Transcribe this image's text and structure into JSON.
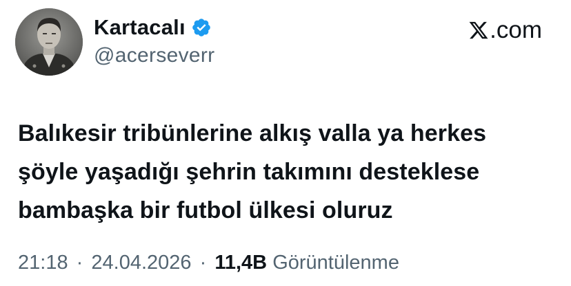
{
  "author": {
    "display_name": "Kartacalı",
    "handle": "@acerseverr",
    "verified": true,
    "verified_badge_color": "#1d9bf0"
  },
  "brand": {
    "label": ".com",
    "icon": "x-logo-icon"
  },
  "tweet": {
    "lines": [
      "Balıkesir tribünlerine alkış valla ya herkes",
      "şöyle yaşadığı şehrin takımını desteklese",
      "bambaşka bir futbol ülkesi oluruz"
    ]
  },
  "meta": {
    "time": "21:18",
    "separator": "·",
    "date": "24.04.2026",
    "views_count": "11,4B",
    "views_label": "Görüntülenme"
  },
  "colors": {
    "text": "#0f1419",
    "muted": "#536471",
    "background": "#ffffff"
  }
}
